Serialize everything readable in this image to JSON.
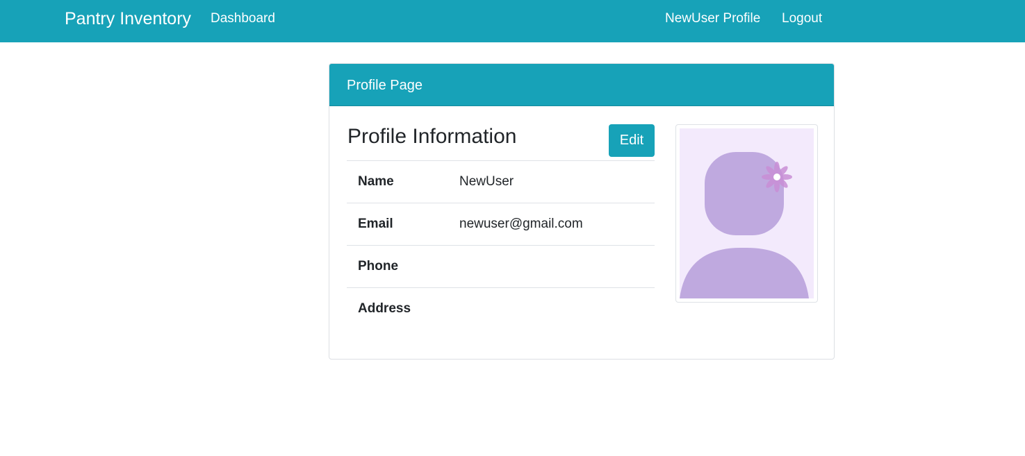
{
  "navbar": {
    "brand": "Pantry Inventory",
    "links": [
      {
        "label": "Dashboard"
      },
      {
        "label": "NewUser Profile"
      },
      {
        "label": "Logout"
      }
    ]
  },
  "card": {
    "header": "Profile Page",
    "section_title": "Profile Information",
    "edit_label": "Edit",
    "rows": [
      {
        "label": "Name",
        "value": "NewUser"
      },
      {
        "label": "Email",
        "value": "newuser@gmail.com"
      },
      {
        "label": "Phone",
        "value": ""
      },
      {
        "label": "Address",
        "value": ""
      }
    ],
    "avatar": {
      "icon": "default-female-avatar",
      "background": "#f3eafc",
      "silhouette": "#bfa9df",
      "flower": "#c98fd6"
    }
  },
  "colors": {
    "primary": "#17a2b8",
    "text": "#212529",
    "border": "#dee2e6"
  }
}
